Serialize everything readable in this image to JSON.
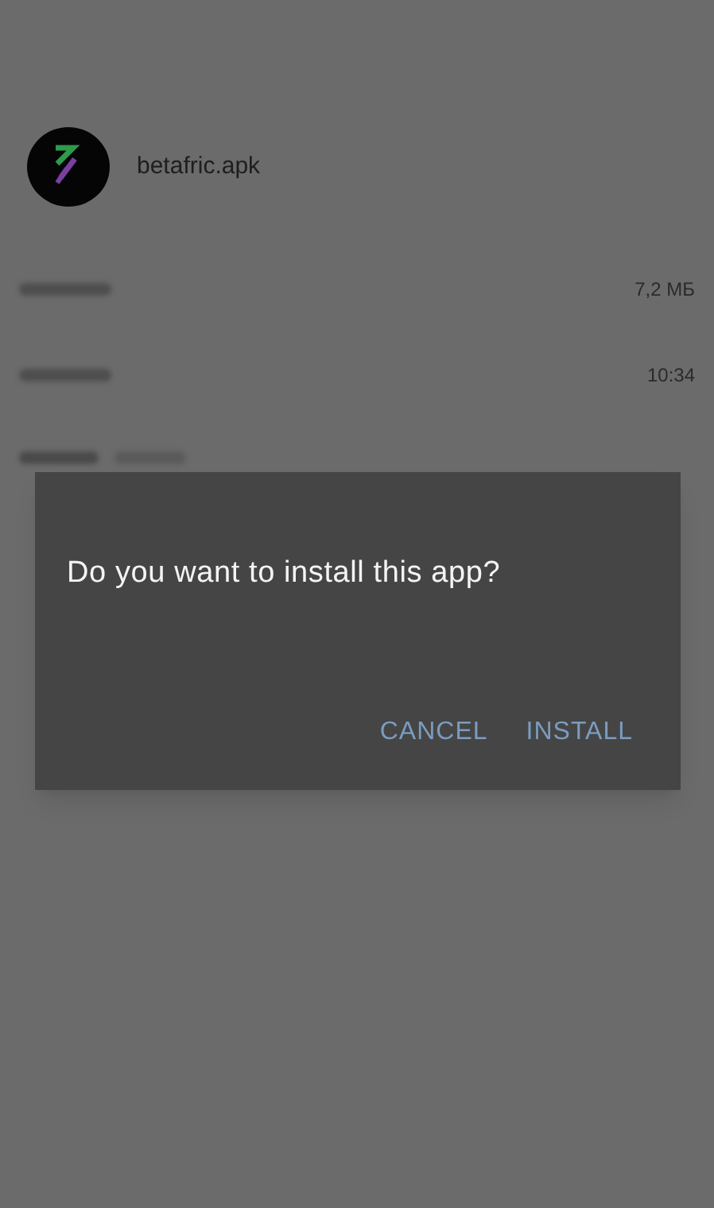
{
  "file": {
    "name": "betafric.apk"
  },
  "details": [
    {
      "value": "7,2 МБ"
    },
    {
      "value": "10:34"
    }
  ],
  "dialog": {
    "message": "Do you want to install this app?",
    "buttons": [
      "CANCEL",
      "INSTALL"
    ]
  }
}
